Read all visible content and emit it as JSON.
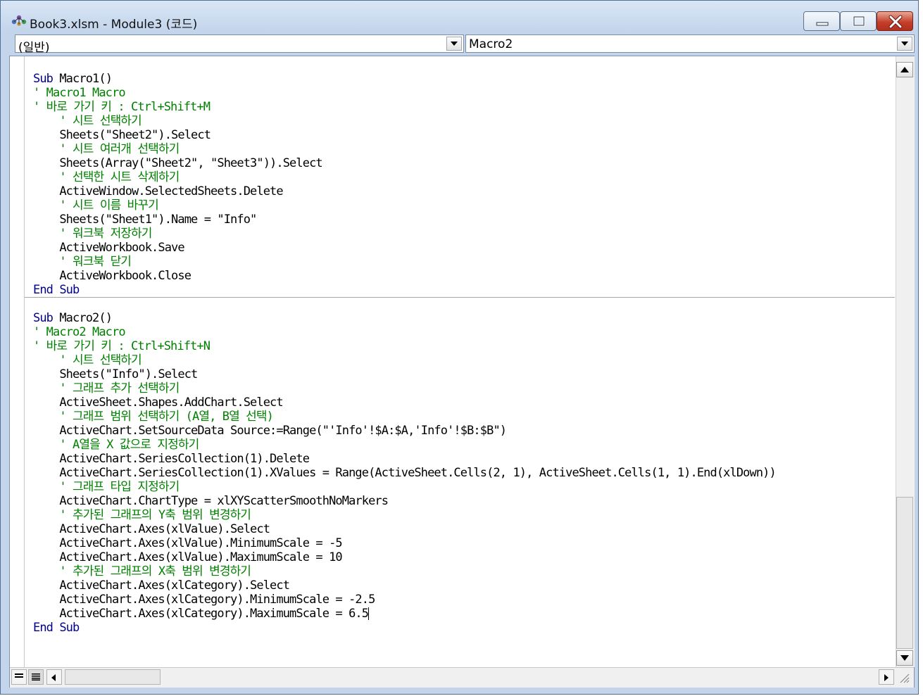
{
  "window": {
    "title": "Book3.xlsm - Module3 (코드)"
  },
  "object_combo": {
    "value": "(일반)"
  },
  "procedure_combo": {
    "value": "Macro2"
  },
  "code": {
    "lines": [
      {
        "kind": "kw",
        "text": "Sub Macro1()"
      },
      {
        "kind": "cmt",
        "text": "' Macro1 Macro"
      },
      {
        "kind": "cmt",
        "text": "' 바로 가기 키 : Ctrl+Shift+M"
      },
      {
        "kind": "cmt",
        "text": "    ' 시트 선택하기"
      },
      {
        "kind": "code",
        "text": "    Sheets(\"Sheet2\").Select"
      },
      {
        "kind": "cmt",
        "text": "    ' 시트 여러개 선택하기"
      },
      {
        "kind": "code",
        "text": "    Sheets(Array(\"Sheet2\", \"Sheet3\")).Select"
      },
      {
        "kind": "cmt",
        "text": "    ' 선택한 시트 삭제하기"
      },
      {
        "kind": "code",
        "text": "    ActiveWindow.SelectedSheets.Delete"
      },
      {
        "kind": "cmt",
        "text": "    ' 시트 이름 바꾸기"
      },
      {
        "kind": "code",
        "text": "    Sheets(\"Sheet1\").Name = \"Info\""
      },
      {
        "kind": "cmt",
        "text": "    ' 워크북 저장하기"
      },
      {
        "kind": "code",
        "text": "    ActiveWorkbook.Save"
      },
      {
        "kind": "cmt",
        "text": "    ' 워크북 닫기"
      },
      {
        "kind": "code",
        "text": "    ActiveWorkbook.Close"
      },
      {
        "kind": "kw",
        "text": "End Sub"
      },
      {
        "kind": "blank",
        "text": ""
      },
      {
        "kind": "kw",
        "text": "Sub Macro2()"
      },
      {
        "kind": "cmt",
        "text": "' Macro2 Macro"
      },
      {
        "kind": "cmt",
        "text": "' 바로 가기 키 : Ctrl+Shift+N"
      },
      {
        "kind": "cmt",
        "text": "    ' 시트 선택하기"
      },
      {
        "kind": "code",
        "text": "    Sheets(\"Info\").Select"
      },
      {
        "kind": "cmt",
        "text": "    ' 그래프 추가 선택하기"
      },
      {
        "kind": "code",
        "text": "    ActiveSheet.Shapes.AddChart.Select"
      },
      {
        "kind": "cmt",
        "text": "    ' 그래프 범위 선택하기 (A열, B열 선택)"
      },
      {
        "kind": "code",
        "text": "    ActiveChart.SetSourceData Source:=Range(\"'Info'!$A:$A,'Info'!$B:$B\")"
      },
      {
        "kind": "cmt",
        "text": "    ' A열을 X 값으로 지정하기"
      },
      {
        "kind": "code",
        "text": "    ActiveChart.SeriesCollection(1).Delete"
      },
      {
        "kind": "code",
        "text": "    ActiveChart.SeriesCollection(1).XValues = Range(ActiveSheet.Cells(2, 1), ActiveSheet.Cells(1, 1).End(xlDown))"
      },
      {
        "kind": "cmt",
        "text": "    ' 그래프 타입 지정하기"
      },
      {
        "kind": "code",
        "text": "    ActiveChart.ChartType = xlXYScatterSmoothNoMarkers"
      },
      {
        "kind": "cmt",
        "text": "    ' 추가된 그래프의 Y축 범위 변경하기"
      },
      {
        "kind": "code",
        "text": "    ActiveChart.Axes(xlValue).Select"
      },
      {
        "kind": "code",
        "text": "    ActiveChart.Axes(xlValue).MinimumScale = -5"
      },
      {
        "kind": "code",
        "text": "    ActiveChart.Axes(xlValue).MaximumScale = 10"
      },
      {
        "kind": "cmt",
        "text": "    ' 추가된 그래프의 X축 범위 변경하기"
      },
      {
        "kind": "code",
        "text": "    ActiveChart.Axes(xlCategory).Select"
      },
      {
        "kind": "code",
        "text": "    ActiveChart.Axes(xlCategory).MinimumScale = -2.5"
      },
      {
        "kind": "code",
        "text": "    ActiveChart.Axes(xlCategory).MaximumScale = 6.5"
      },
      {
        "kind": "kw",
        "text": "End Sub"
      }
    ],
    "caret_line": 38
  },
  "icons": {
    "app": "vba-project-icon",
    "minimize": "minimize-icon",
    "maximize": "maximize-icon",
    "close": "close-icon",
    "dropdown": "chevron-down-icon",
    "procedure_view": "procedure-view-icon",
    "full_module_view": "full-module-view-icon"
  },
  "colors": {
    "keyword": "#00008b",
    "comment": "#008000",
    "code": "#000000",
    "close_button": "#c4402a"
  }
}
